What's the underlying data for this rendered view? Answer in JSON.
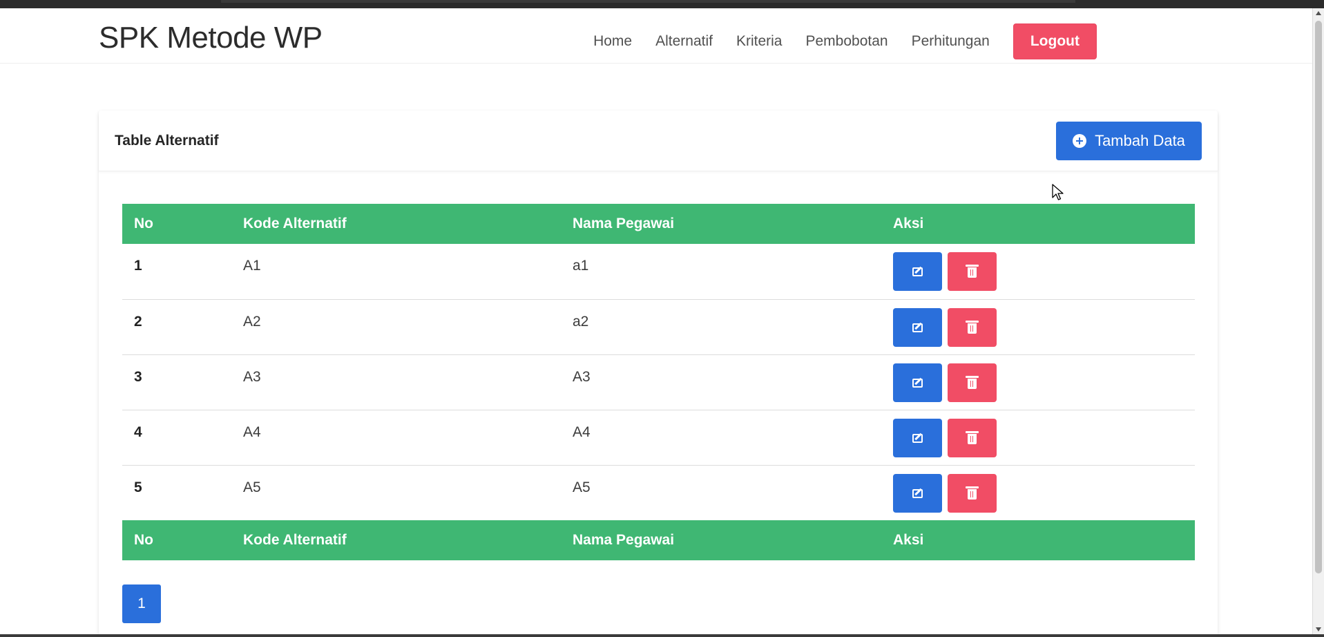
{
  "navbar": {
    "brand": "SPK Metode WP",
    "links": [
      "Home",
      "Alternatif",
      "Kriteria",
      "Pembobotan",
      "Perhitungan"
    ],
    "logout_label": "Logout"
  },
  "card": {
    "title": "Table Alternatif",
    "add_button_label": "Tambah Data"
  },
  "table": {
    "columns": [
      "No",
      "Kode Alternatif",
      "Nama Pegawai",
      "Aksi"
    ],
    "rows": [
      {
        "no": "1",
        "kode": "A1",
        "nama": "a1"
      },
      {
        "no": "2",
        "kode": "A2",
        "nama": "a2"
      },
      {
        "no": "3",
        "kode": "A3",
        "nama": "A3"
      },
      {
        "no": "4",
        "kode": "A4",
        "nama": "A4"
      },
      {
        "no": "5",
        "kode": "A5",
        "nama": "A5"
      }
    ]
  },
  "pagination": {
    "current_page": "1"
  },
  "colors": {
    "primary": "#2a6fdb",
    "danger": "#f14d65",
    "table_header": "#3fb773"
  },
  "icons": {
    "add": "plus-circle-icon",
    "edit": "edit-icon",
    "delete": "trash-icon"
  }
}
